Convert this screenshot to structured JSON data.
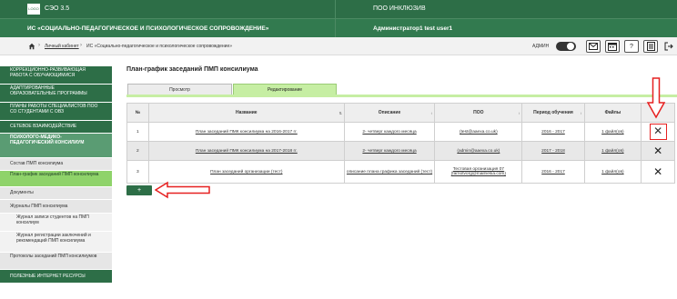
{
  "header": {
    "logo": "LOGO",
    "app_name": "СЭО 3.5",
    "poo_title": "ПОО ИНКЛЮЗИВ",
    "ic_title": "ИС «СОЦИАЛЬНО-ПЕДАГОГИЧЕСКОЕ И ПСИХОЛОГИЧЕСКОЕ СОПРОВОЖДЕНИЕ»",
    "user_name": "Администратор1 test user1"
  },
  "breadcrumb": {
    "home_icon": "home-icon",
    "link": "Личный кабинет",
    "current": "ИС «Социально-педагогическое и психологическое сопровождение»",
    "admin_label": "АДМИН"
  },
  "toolbar_icons": [
    "mail-icon",
    "calendar-icon",
    "help-icon",
    "document-icon",
    "logout-icon"
  ],
  "sidebar": {
    "items": [
      {
        "label": "КОРРЕКЦИОННО-РАЗВИВАЮЩАЯ РАБОТА С ОБУЧАЮЩИМИСЯ"
      },
      {
        "label": "АДАПТИРОВАННЫЕ ОБРАЗОВАТЕЛЬНЫЕ ПРОГРАММЫ"
      },
      {
        "label": "ПЛАНЫ РАБОТЫ СПЕЦИАЛИСТОВ ПОО СО СТУДЕНТАМИ С ОВЗ"
      },
      {
        "label": "СЕТЕВОЕ ВЗАИМОДЕЙСТВИЕ"
      },
      {
        "label": "ПСИХОЛОГО-МЕДИКО-ПЕДАГОГИЧЕСКИЙ КОНСИЛИУМ"
      },
      {
        "label": "Состав ПМП консилиума"
      },
      {
        "label": "План-график заседаний ПМП консилиума"
      },
      {
        "label": "Документы"
      },
      {
        "label": "Журналы ПМП консилиума"
      },
      {
        "label": "Журнал записи студентов на ПМП консилиум"
      },
      {
        "label": "Журнал регистрации заключений и рекомендаций ПМП консилиума"
      },
      {
        "label": "Протоколы заседаний ПМП консилиумов"
      },
      {
        "label": "ПОЛЕЗНЫЕ ИНТЕРНЕТ РЕСУРСЫ"
      }
    ]
  },
  "main": {
    "title": "План-график заседаний ПМП консилиума",
    "tabs": [
      {
        "label": "Просмотр"
      },
      {
        "label": "Редактирование"
      }
    ],
    "columns": [
      "№",
      "Название",
      "Описание",
      "ПОО",
      "Период обучения",
      "Файлы",
      ""
    ],
    "rows": [
      {
        "num": "1",
        "name": "План заседаний ПМК консилиума на 2016-2017 гг.",
        "desc": "2- четверг каждого месяца",
        "poo": "(test@aaexa.co.uk)",
        "period": "2016 - 2017",
        "files": "1 файл(ов)"
      },
      {
        "num": "2",
        "name": "План заседаний ПМК консилиума на 2017-2018 гг.",
        "desc": "2- четверг каждого месяца",
        "poo": "(admin@aaexa.co.uk)",
        "period": "2017 - 2018",
        "files": "1 файл(ов)"
      },
      {
        "num": "3",
        "name": "План заседаний организации (тест)",
        "desc": "описание плана графика заседаний (тест)",
        "poo": "Тестовая организация 07 (farnotvorg@mailnesia.com)",
        "period": "2016 - 2017",
        "files": "1 файл(ов)"
      }
    ],
    "add_button": "+"
  },
  "colors": {
    "header_green": "#2d6e47",
    "active_tab": "#c6eea3",
    "annotation_red": "#e62020"
  }
}
